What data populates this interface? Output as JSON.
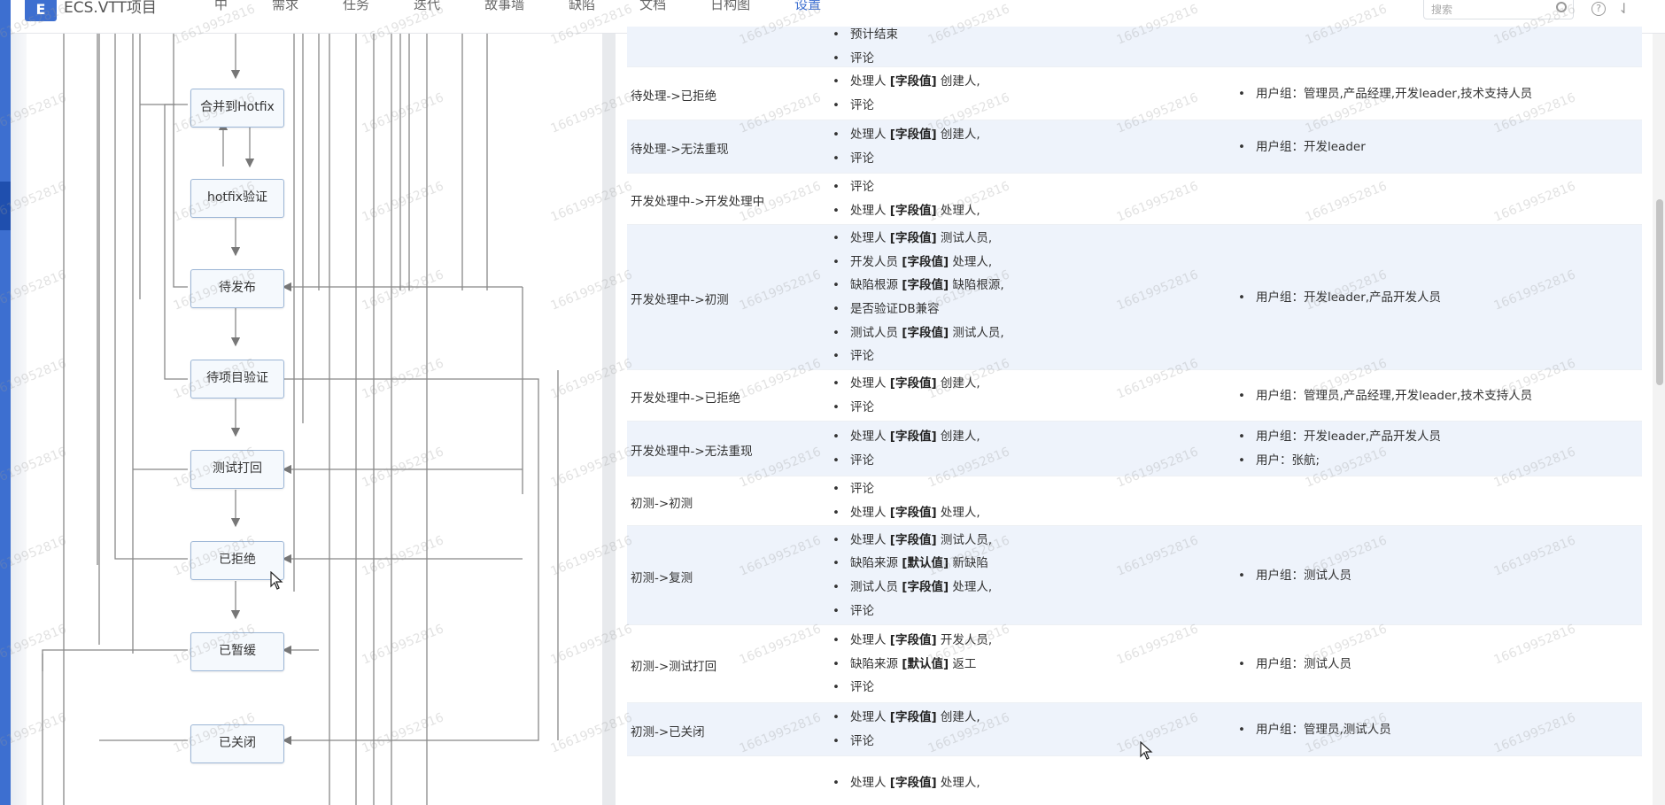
{
  "header": {
    "logo_letter": "E",
    "project_title": "ECS.VTT项目",
    "nav_items": [
      "中",
      "需求",
      "任务",
      "迭代",
      "故事墙",
      "缺陷",
      "文档",
      "日构图",
      "设置"
    ],
    "active_nav": "设置",
    "search_placeholder": "搜索"
  },
  "diagram": {
    "nodes": [
      "合并到Hotfix",
      "hotfix验证",
      "待发布",
      "待项目验证",
      "测试打回",
      "已拒绝",
      "已暂缓",
      "已关闭"
    ]
  },
  "table": {
    "rows": [
      {
        "transition": "",
        "conditions": [
          "预计结束",
          "评论"
        ],
        "permissions": []
      },
      {
        "transition": "待处理->已拒绝",
        "conditions": [
          {
            "pre": "处理人 ",
            "tag": "[字段值]",
            "post": " 创建人,"
          },
          "评论"
        ],
        "permissions": [
          "用户组：管理员,产品经理,开发leader,技术支持人员"
        ]
      },
      {
        "transition": "待处理->无法重现",
        "conditions": [
          {
            "pre": "处理人 ",
            "tag": "[字段值]",
            "post": " 创建人,"
          },
          "评论"
        ],
        "permissions": [
          "用户组：开发leader"
        ]
      },
      {
        "transition": "开发处理中->开发处理中",
        "conditions": [
          "评论",
          {
            "pre": "处理人 ",
            "tag": "[字段值]",
            "post": " 处理人,"
          }
        ],
        "permissions": []
      },
      {
        "transition": "开发处理中->初测",
        "conditions": [
          {
            "pre": "处理人 ",
            "tag": "[字段值]",
            "post": " 测试人员,"
          },
          {
            "pre": "开发人员 ",
            "tag": "[字段值]",
            "post": " 处理人,"
          },
          {
            "pre": "缺陷根源 ",
            "tag": "[字段值]",
            "post": " 缺陷根源,"
          },
          "是否验证DB兼容",
          {
            "pre": "测试人员 ",
            "tag": "[字段值]",
            "post": " 测试人员,"
          },
          "评论"
        ],
        "permissions": [
          "用户组：开发leader,产品开发人员"
        ]
      },
      {
        "transition": "开发处理中->已拒绝",
        "conditions": [
          {
            "pre": "处理人 ",
            "tag": "[字段值]",
            "post": " 创建人,"
          },
          "评论"
        ],
        "permissions": [
          "用户组：管理员,产品经理,开发leader,技术支持人员"
        ]
      },
      {
        "transition": "开发处理中->无法重现",
        "conditions": [
          {
            "pre": "处理人 ",
            "tag": "[字段值]",
            "post": " 创建人,"
          },
          "评论"
        ],
        "permissions": [
          "用户组：开发leader,产品开发人员",
          "用户：张航;"
        ]
      },
      {
        "transition": "初测->初测",
        "conditions": [
          "评论",
          {
            "pre": "处理人 ",
            "tag": "[字段值]",
            "post": " 处理人,"
          }
        ],
        "permissions": []
      },
      {
        "transition": "初测->复测",
        "conditions": [
          {
            "pre": "处理人 ",
            "tag": "[字段值]",
            "post": " 测试人员,"
          },
          {
            "pre": "缺陷来源 ",
            "tag": "[默认值]",
            "post": " 新缺陷"
          },
          {
            "pre": "测试人员 ",
            "tag": "[字段值]",
            "post": " 处理人,"
          },
          "评论"
        ],
        "permissions": [
          "用户组：测试人员"
        ]
      },
      {
        "transition": "初测->测试打回",
        "conditions": [
          {
            "pre": "处理人 ",
            "tag": "[字段值]",
            "post": " 开发人员,"
          },
          {
            "pre": "缺陷来源 ",
            "tag": "[默认值]",
            "post": " 返工"
          },
          "评论"
        ],
        "permissions": [
          "用户组：测试人员"
        ]
      },
      {
        "transition": "初测->已关闭",
        "conditions": [
          {
            "pre": "处理人 ",
            "tag": "[字段值]",
            "post": " 创建人,"
          },
          "评论"
        ],
        "permissions": [
          "用户组：管理员,测试人员"
        ]
      },
      {
        "transition": "",
        "conditions": [
          {
            "pre": "处理人 ",
            "tag": "[字段值]",
            "post": " 处理人,"
          }
        ],
        "permissions": []
      }
    ]
  },
  "watermark": "16619952816"
}
